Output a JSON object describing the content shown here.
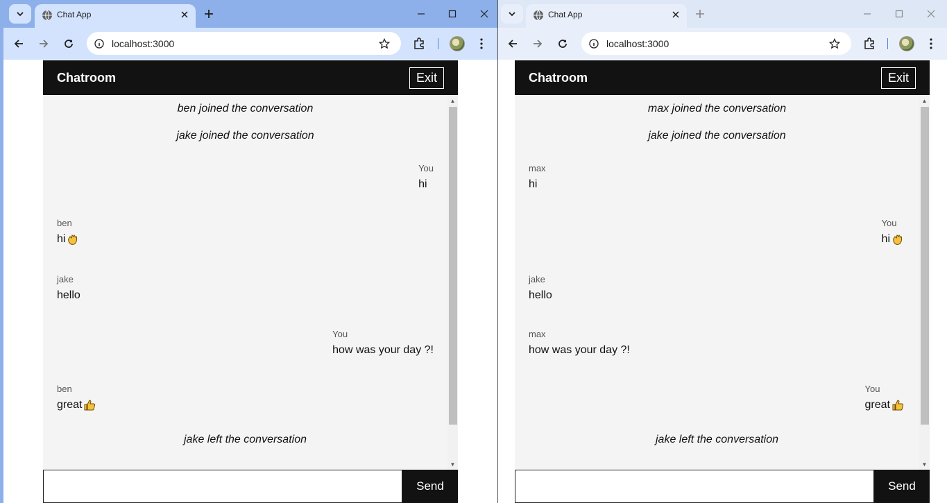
{
  "colors": {
    "active_tabstrip": "#8db0ea",
    "toolbar": "#d3e3fd",
    "chat_header": "#121212",
    "messages_bg": "#f4f4f4"
  },
  "left": {
    "tab_title": "Chat App",
    "url": "localhost:3000",
    "chat": {
      "title": "Chatroom",
      "exit_label": "Exit",
      "send_label": "Send",
      "input_value": "",
      "system": [
        "ben joined the conversation",
        "jake joined the conversation",
        "jake left the conversation"
      ],
      "messages": [
        {
          "sender": "You",
          "text": "hi",
          "mine": true
        },
        {
          "sender": "ben",
          "text": "hi",
          "emoji": "waving-hand-icon",
          "mine": false
        },
        {
          "sender": "jake",
          "text": "hello",
          "mine": false
        },
        {
          "sender": "You",
          "text": "how was your day ?!",
          "mine": true
        },
        {
          "sender": "ben",
          "text": "great",
          "emoji": "thumbs-up-icon",
          "mine": false
        }
      ]
    }
  },
  "right": {
    "tab_title": "Chat App",
    "url": "localhost:3000",
    "chat": {
      "title": "Chatroom",
      "exit_label": "Exit",
      "send_label": "Send",
      "input_value": "",
      "system": [
        "max joined the conversation",
        "jake joined the conversation",
        "jake left the conversation"
      ],
      "messages": [
        {
          "sender": "max",
          "text": "hi",
          "mine": false
        },
        {
          "sender": "You",
          "text": "hi",
          "emoji": "waving-hand-icon",
          "mine": true
        },
        {
          "sender": "jake",
          "text": "hello",
          "mine": false
        },
        {
          "sender": "max",
          "text": "how was your day ?!",
          "mine": false
        },
        {
          "sender": "You",
          "text": "great",
          "emoji": "thumbs-up-icon",
          "mine": true
        }
      ]
    }
  }
}
